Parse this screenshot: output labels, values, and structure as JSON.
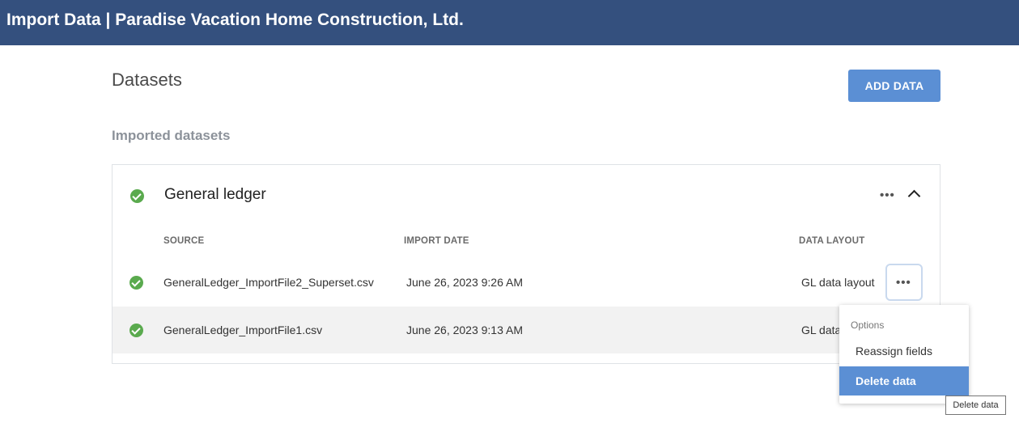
{
  "header": {
    "title": "Import Data | Paradise Vacation Home Construction, Ltd."
  },
  "page": {
    "title": "Datasets",
    "add_button": "ADD DATA",
    "subtitle": "Imported datasets"
  },
  "group": {
    "title": "General ledger",
    "status": "check-circle-icon",
    "columns": {
      "source": "SOURCE",
      "import_date": "IMPORT DATE",
      "data_layout": "DATA LAYOUT"
    },
    "rows": [
      {
        "source": "GeneralLedger_ImportFile2_Superset.csv",
        "import_date": "June 26, 2023 9:26 AM",
        "data_layout": "GL data layout"
      },
      {
        "source": "GeneralLedger_ImportFile1.csv",
        "import_date": "June 26, 2023 9:13 AM",
        "data_layout": "GL data"
      }
    ]
  },
  "context_menu": {
    "header": "Options",
    "items": [
      "Reassign fields",
      "Delete data"
    ],
    "selected": "Delete data"
  },
  "tooltip": "Delete data",
  "icons": {
    "more": "ellipsis-icon",
    "collapse": "chevron-up-icon"
  },
  "colors": {
    "header_bg": "#34507e",
    "accent": "#5b8fd4",
    "success": "#5aaa4e"
  }
}
